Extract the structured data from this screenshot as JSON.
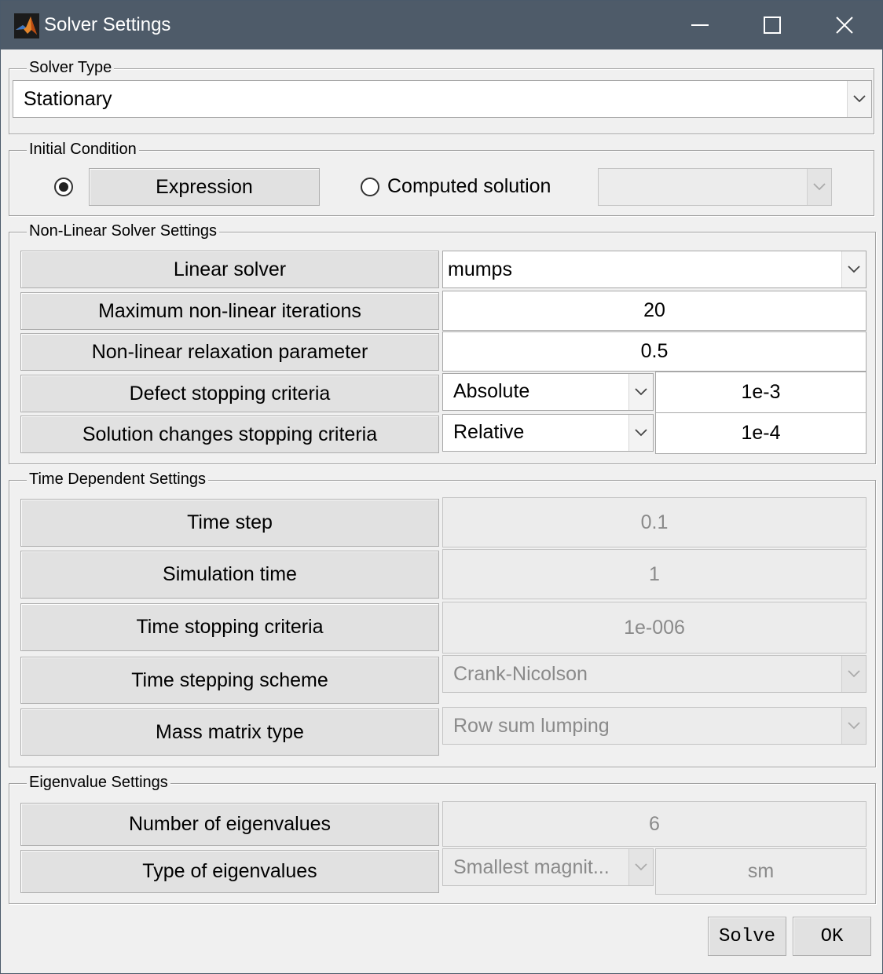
{
  "window": {
    "title": "Solver Settings",
    "icons": {
      "app": "matlab-logo-icon",
      "minimize": "minimize-icon",
      "maximize": "maximize-icon",
      "close": "close-icon"
    }
  },
  "solver_type": {
    "legend": "Solver Type",
    "selected": "Stationary"
  },
  "initial_condition": {
    "legend": "Initial Condition",
    "expression_selected": true,
    "expression_button": "Expression",
    "computed_label": "Computed solution",
    "computed_selected": false,
    "computed_value": ""
  },
  "nonlinear": {
    "legend": "Non-Linear Solver Settings",
    "linear_solver_label": "Linear solver",
    "linear_solver_value": "mumps",
    "max_iter_label": "Maximum non-linear iterations",
    "max_iter_value": "20",
    "relax_label": "Non-linear relaxation parameter",
    "relax_value": "0.5",
    "defect_label": "Defect stopping criteria",
    "defect_mode": "Absolute",
    "defect_value": "1e-3",
    "sol_change_label": "Solution changes stopping criteria",
    "sol_change_mode": "Relative",
    "sol_change_value": "1e-4"
  },
  "time": {
    "legend": "Time Dependent Settings",
    "step_label": "Time step",
    "step_value": "0.1",
    "sim_label": "Simulation time",
    "sim_value": "1",
    "stop_label": "Time stopping criteria",
    "stop_value": "1e-006",
    "scheme_label": "Time stepping scheme",
    "scheme_value": "Crank-Nicolson",
    "mass_label": "Mass matrix type",
    "mass_value": "Row sum lumping"
  },
  "eigen": {
    "legend": "Eigenvalue Settings",
    "num_label": "Number of eigenvalues",
    "num_value": "6",
    "type_label": "Type of eigenvalues",
    "type_value": "Smallest magnit...",
    "type_code": "sm"
  },
  "buttons": {
    "solve": "Solve",
    "ok": "OK"
  },
  "colors": {
    "titlebar": "#4e5b69",
    "background": "#f0f0f0",
    "disabled_text": "#8a8a8a"
  }
}
